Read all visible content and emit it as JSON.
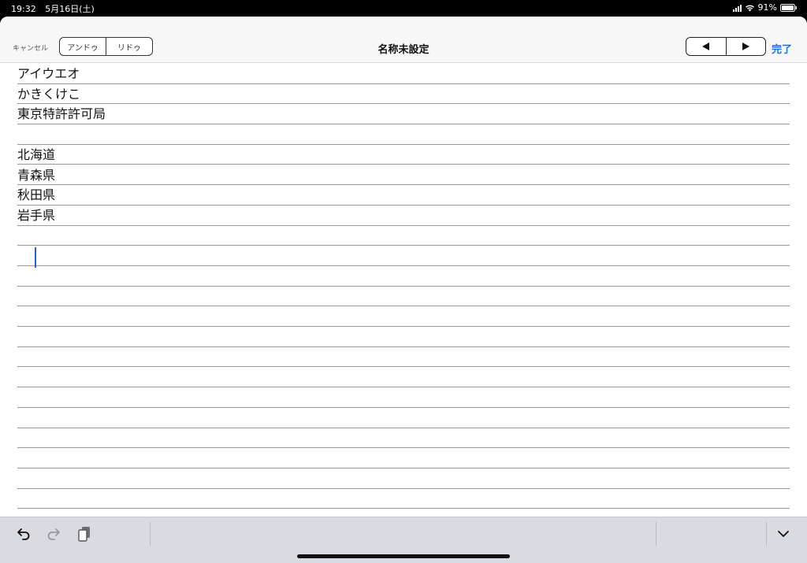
{
  "status_bar": {
    "time": "19:32",
    "date": "5月16日(土)",
    "battery": "91%"
  },
  "nav": {
    "cancel_label": "キャンセル",
    "undo_label": "アンドゥ",
    "redo_label": "リドゥ",
    "title": "名称未設定",
    "prev_icon": "triangle-left-icon",
    "next_icon": "triangle-right-icon",
    "done_label": "完了"
  },
  "colors": {
    "accent": "#1a73e8",
    "cursor": "#2660e0",
    "rule_line": "#9a9a9a",
    "toolbar_bg": "#d9dbe0"
  },
  "note": {
    "lines": [
      "アイウエオ",
      "かきくけこ",
      "東京特許許可局",
      "",
      "北海道",
      "青森県",
      "秋田県",
      "岩手県",
      "",
      "",
      "",
      "",
      "",
      "",
      "",
      "",
      "",
      "",
      "",
      "",
      "",
      "",
      ""
    ],
    "cursor_line": 9
  },
  "toolbar": {
    "undo_icon": "undo-arrow-icon",
    "redo_icon": "redo-arrow-icon",
    "paste_icon": "clipboard-icon",
    "dismiss_icon": "chevron-down-icon"
  }
}
